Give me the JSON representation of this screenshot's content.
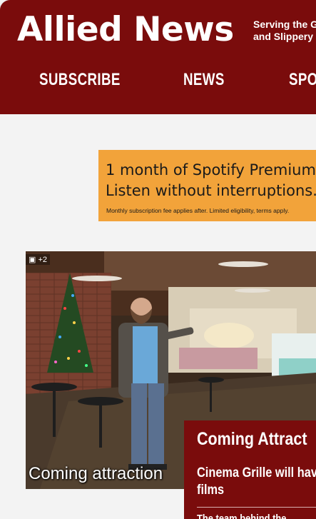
{
  "header": {
    "brand": "Allied News",
    "tagline": [
      "Serving the Gro",
      "and Slippery Ro"
    ],
    "nav": [
      {
        "label": "SUBSCRIBE"
      },
      {
        "label": "NEWS"
      },
      {
        "label": "SPO"
      }
    ]
  },
  "ad": {
    "line1": "1 month of Spotify Premium,",
    "line2": "Listen without interruptions.",
    "fine": "Monthly subscription fee applies after. Limited eligibility, terms apply."
  },
  "feature": {
    "photo_count": "+2",
    "caption": "Coming attraction",
    "card_title": "Coming Attract",
    "headline": "Cinema Grille will have films",
    "next_headline": "The team behind the"
  },
  "colors": {
    "brand": "#7a0c0c",
    "ad": "#f2a33a",
    "background": "#f3f3f3"
  }
}
